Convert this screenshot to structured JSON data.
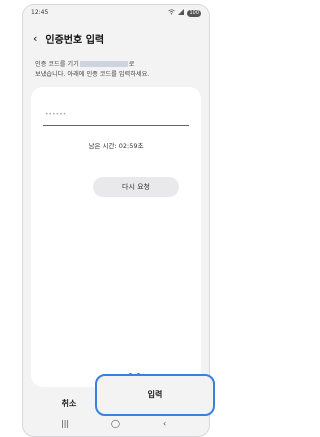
{
  "status": {
    "time": "12:45",
    "battery": "100",
    "signal_icon": "signal-icon",
    "wifi_icon": "wifi-icon"
  },
  "header": {
    "back_icon": "chevron-left-icon",
    "title": "인증번호 입력"
  },
  "description": {
    "line1_prefix": "인증 코드를 기기",
    "line1_suffix": "로",
    "line2": "보냈습니다. 아래에 인증 코드를 입력하세요."
  },
  "code_input": {
    "placeholder": "••••••"
  },
  "timer": {
    "text": "남은 시간: 02:59초"
  },
  "buttons": {
    "resend": "다시 요청",
    "cancel": "취소",
    "enter": "입력"
  },
  "navbar": {
    "recent": "|||",
    "home": "◯",
    "back": "‹"
  },
  "colors": {
    "accent": "#3b7fe0",
    "background": "#f3f3f4",
    "card": "#ffffff"
  }
}
